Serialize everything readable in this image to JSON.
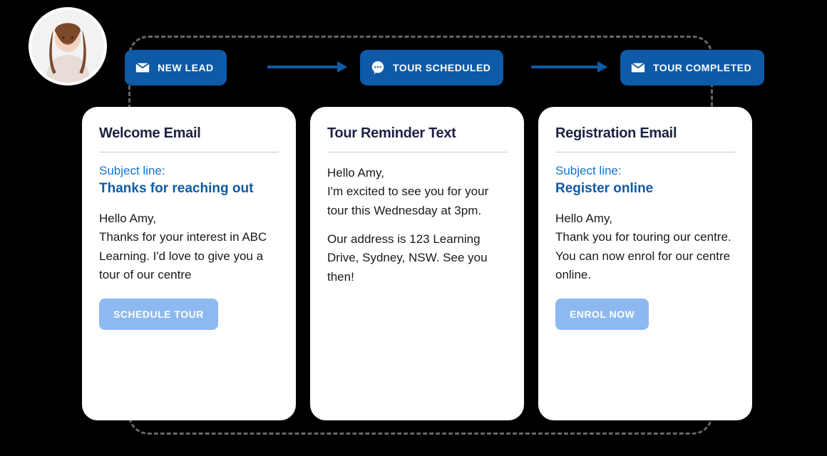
{
  "stages": [
    {
      "label": "NEW LEAD",
      "icon": "mail"
    },
    {
      "label": "TOUR SCHEDULED",
      "icon": "chat"
    },
    {
      "label": "TOUR COMPLETED",
      "icon": "mail"
    }
  ],
  "cards": [
    {
      "title": "Welcome Email",
      "subject_label": "Subject line:",
      "subject_value": "Thanks for reaching out",
      "body": "Hello Amy,\nThanks for your interest in ABC Learning. I'd love to give you a tour of our centre",
      "cta": "SCHEDULE TOUR"
    },
    {
      "title": "Tour Reminder Text",
      "body1": "Hello Amy,\nI'm excited to see you for your tour this Wednesday at 3pm.",
      "body2": "Our address is 123 Learning Drive, Sydney, NSW. See you then!"
    },
    {
      "title": "Registration Email",
      "subject_label": "Subject line:",
      "subject_value": "Register online",
      "body": "Hello Amy,\nThank you for touring our centre. You can now enrol for our centre online.",
      "cta": "ENROL NOW"
    }
  ]
}
